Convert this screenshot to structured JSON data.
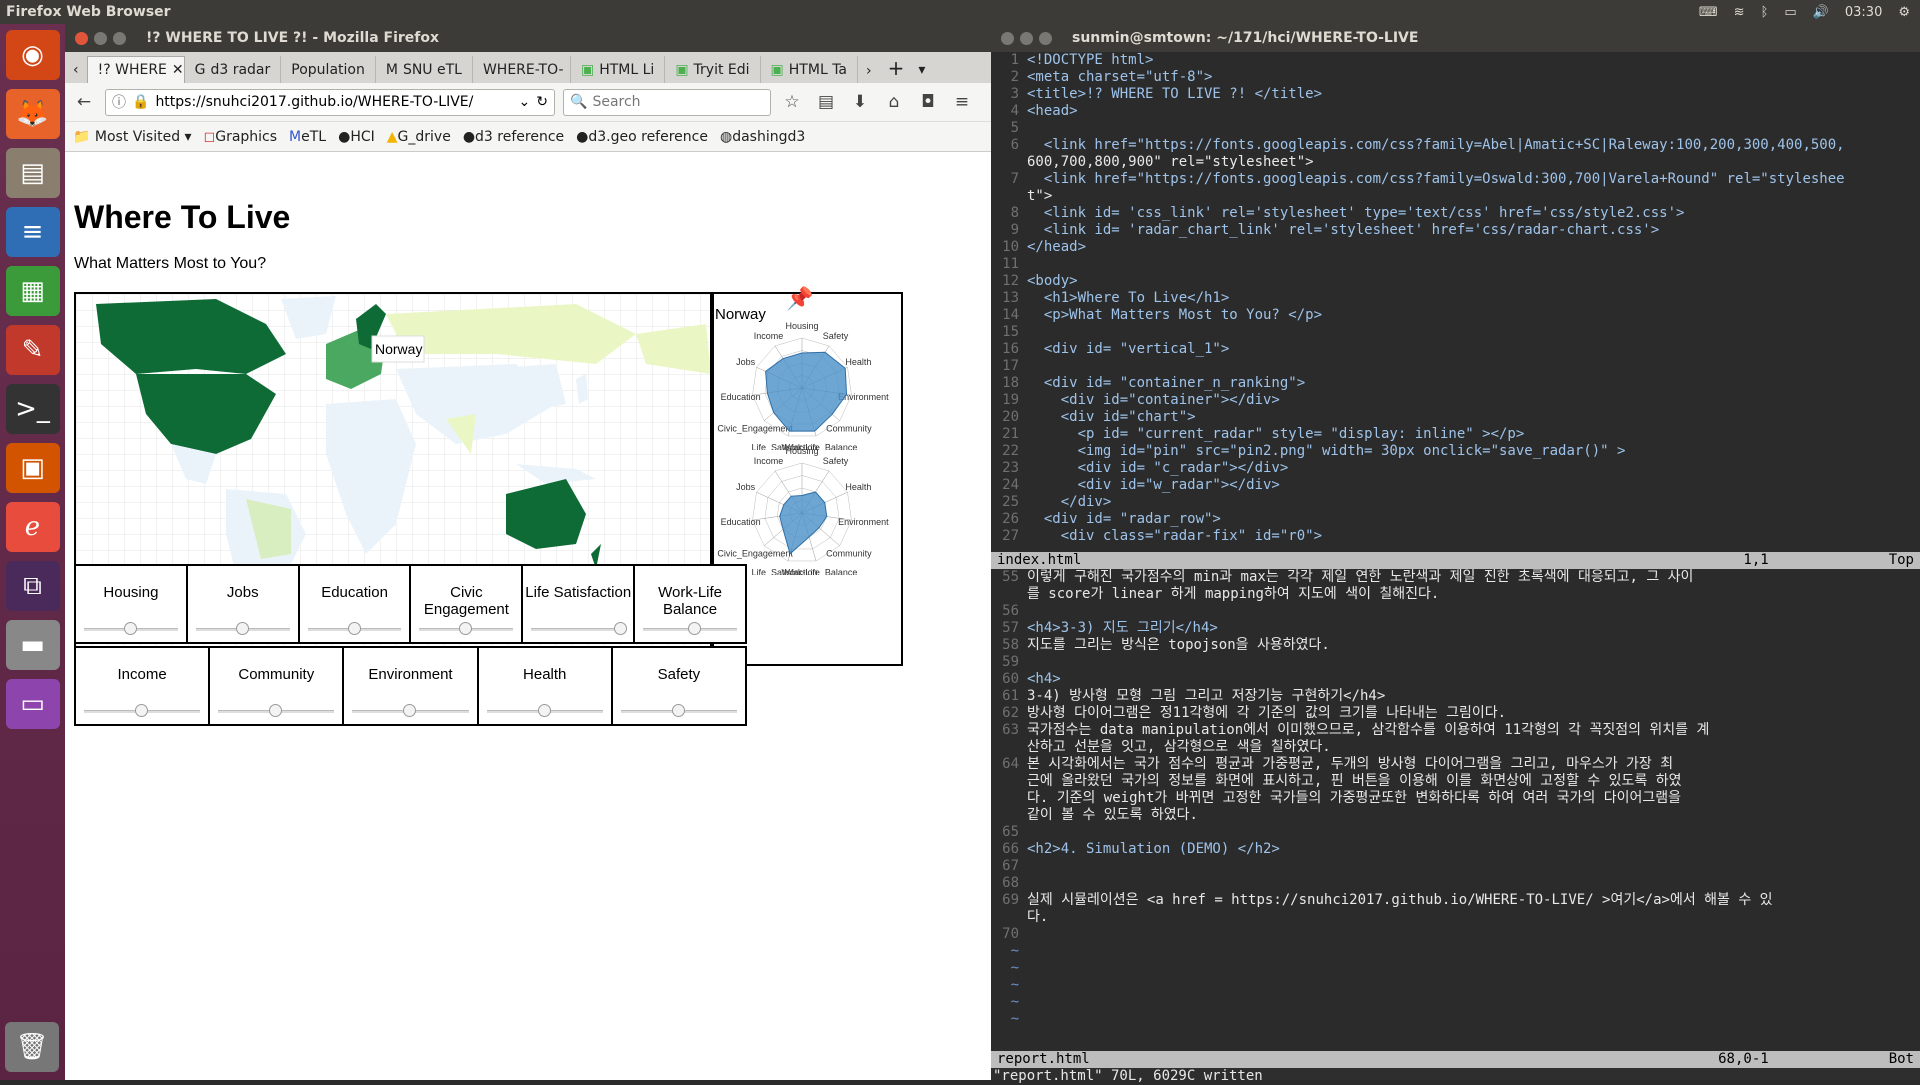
{
  "topbar": {
    "app": "Firefox Web Browser",
    "time": "03:30"
  },
  "firefox": {
    "title": "!? WHERE TO LIVE ?! - Mozilla Firefox",
    "tabs": [
      "!? WHERE",
      "d3 radar",
      "Population",
      "SNU eTL",
      "WHERE-TO-",
      "HTML Li",
      "Tryit Edi",
      "HTML Ta"
    ],
    "url": "https://snuhci2017.github.io/WHERE-TO-LIVE/",
    "search_placeholder": "Search",
    "bookmarks": [
      "Most Visited",
      "Graphics",
      "eTL",
      "HCI",
      "G_drive",
      "d3 reference",
      "d3.geo reference",
      "dashingd3"
    ]
  },
  "page": {
    "heading": "Where To Live",
    "subtitle": "What Matters Most to You?",
    "map_tooltip": "Norway",
    "radar_title": "Norway",
    "radar_axes": [
      "Housing",
      "Safety",
      "Health",
      "Environment",
      "Community",
      "Work-Life_Balance",
      "Life_Satisfaction",
      "Civic_Engagement",
      "Education",
      "Jobs",
      "Income"
    ],
    "sliders_row1": [
      {
        "label": "Housing",
        "value": 0.5
      },
      {
        "label": "Jobs",
        "value": 0.5
      },
      {
        "label": "Education",
        "value": 0.5
      },
      {
        "label": "Civic Engagement",
        "value": 0.5
      },
      {
        "label": "Life Satisfaction",
        "value": 0.95
      },
      {
        "label": "Work-Life Balance",
        "value": 0.55
      }
    ],
    "sliders_row2": [
      {
        "label": "Income",
        "value": 0.5
      },
      {
        "label": "Community",
        "value": 0.5
      },
      {
        "label": "Environment",
        "value": 0.5
      },
      {
        "label": "Health",
        "value": 0.5
      },
      {
        "label": "Safety",
        "value": 0.5
      }
    ]
  },
  "terminal": {
    "title": "sunmin@smtown: ~/171/hci/WHERE-TO-LIVE",
    "top_lines": [
      [
        "1",
        "<!DOCTYPE html>"
      ],
      [
        "2",
        "<meta charset=\"utf-8\">"
      ],
      [
        "3",
        "<title>!? WHERE TO LIVE ?! </title>"
      ],
      [
        "4",
        "<head>"
      ],
      [
        "5",
        ""
      ],
      [
        "6",
        "  <link href=\"https://fonts.googleapis.com/css?family=Abel|Amatic+SC|Raleway:100,200,300,400,500,"
      ],
      [
        "",
        "600,700,800,900\" rel=\"stylesheet\">"
      ],
      [
        "7",
        "  <link href=\"https://fonts.googleapis.com/css?family=Oswald:300,700|Varela+Round\" rel=\"styleshee"
      ],
      [
        "",
        "t\">"
      ],
      [
        "8",
        "  <link id= 'css_link' rel='stylesheet' type='text/css' href='css/style2.css'>"
      ],
      [
        "9",
        "  <link id= 'radar_chart_link' rel='stylesheet' href='css/radar-chart.css'>"
      ],
      [
        "10",
        "</head>"
      ],
      [
        "11",
        ""
      ],
      [
        "12",
        "<body>"
      ],
      [
        "13",
        "  <h1>Where To Live</h1>"
      ],
      [
        "14",
        "  <p>What Matters Most to You? </p>"
      ],
      [
        "15",
        ""
      ],
      [
        "16",
        "  <div id= \"vertical_1\">"
      ],
      [
        "17",
        ""
      ],
      [
        "18",
        "  <div id= \"container_n_ranking\">"
      ],
      [
        "19",
        "    <div id=\"container\"></div>"
      ],
      [
        "20",
        "    <div id=\"chart\">"
      ],
      [
        "21",
        "      <p id= \"current_radar\" style= \"display: inline\" ></p>"
      ],
      [
        "22",
        "      <img id=\"pin\" src=\"pin2.png\" width= 30px onclick=\"save_radar()\" >"
      ],
      [
        "23",
        "      <div id= \"c_radar\"></div>"
      ],
      [
        "24",
        "      <div id=\"w_radar\"></div>"
      ],
      [
        "25",
        "    </div>"
      ],
      [
        "26",
        "  <div id= \"radar_row\">"
      ],
      [
        "27",
        "    <div class=\"radar-fix\" id=\"r0\">"
      ]
    ],
    "top_status": {
      "file": "index.html",
      "pos": "1,1",
      "scroll": "Top"
    },
    "bottom_lines": [
      [
        "55",
        "이렇게 구해진 국가점수의 min과 max는 각각 제일 연한 노란색과 제일 진한 초록색에 대응되고, 그 사이"
      ],
      [
        "",
        "를 score가 linear 하게 mapping하여 지도에 색이 칠해진다."
      ],
      [
        "56",
        ""
      ],
      [
        "57",
        "<h4>3-3) 지도 그리기</h4>"
      ],
      [
        "58",
        "지도를 그리는 방식은 topojson을 사용하였다."
      ],
      [
        "59",
        ""
      ],
      [
        "60",
        "<h4>"
      ],
      [
        "61",
        "3-4) 방사형 모형 그림 그리고 저장기능 구현하기</h4>"
      ],
      [
        "62",
        "방사형 다이어그램은 정11각형에 각 기준의 값의 크기를 나타내는 그림이다."
      ],
      [
        "63",
        "국가점수는 data manipulation에서 이미했으므로, 삼각함수를 이용하여 11각형의 각 꼭짓점의 위치를 계"
      ],
      [
        "",
        "산하고 선분을 잇고, 삼각형으로 색을 칠하였다."
      ],
      [
        "64",
        "본 시각화에서는 국가 점수의 평균과 가중평균, 두개의 방사형 다이어그램을 그리고, 마우스가 가장 최"
      ],
      [
        "",
        "근에 올라왔던 국가의 정보를 화면에 표시하고, 핀 버튼을 이용해 이를 화면상에 고정할 수 있도록 하였"
      ],
      [
        "",
        "다. 기준의 weight가 바뀌면 고정한 국가들의 가중평균또한 변화하다록 하여 여러 국가의 다이어그램을"
      ],
      [
        "",
        "같이 볼 수 있도록 하였다."
      ],
      [
        "65",
        ""
      ],
      [
        "66",
        "<h2>4. Simulation (DEMO) </h2>"
      ],
      [
        "67",
        ""
      ],
      [
        "68",
        ""
      ],
      [
        "69",
        "실제 시뮬레이션은 <a href = https://snuhci2017.github.io/WHERE-TO-LIVE/ >여기</a>에서 해볼 수 있"
      ],
      [
        "",
        "다."
      ],
      [
        "70",
        ""
      ],
      [
        "~",
        ""
      ],
      [
        "~",
        ""
      ],
      [
        "~",
        ""
      ],
      [
        "~",
        ""
      ],
      [
        "~",
        ""
      ]
    ],
    "bottom_status": {
      "file": "report.html",
      "pos": "68,0-1",
      "scroll": "Bot"
    },
    "cmdline": "\"report.html\" 70L, 6029C written"
  }
}
